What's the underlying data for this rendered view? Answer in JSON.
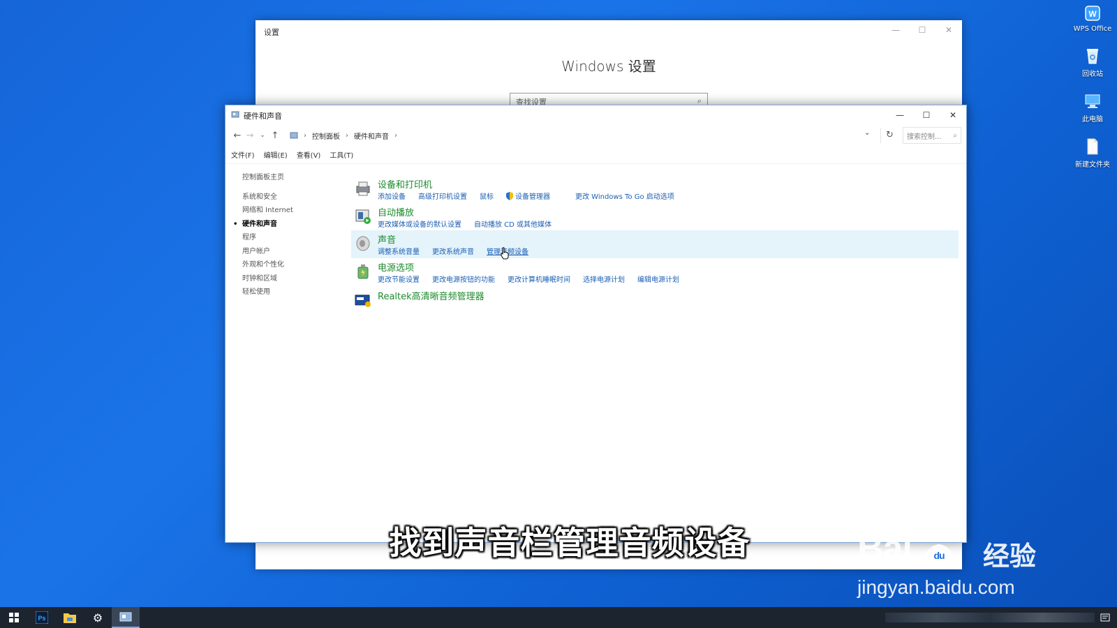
{
  "desktop": {
    "icons": [
      {
        "label": "WPS Office",
        "icon": "wps-office-icon"
      },
      {
        "label": "回收站",
        "icon": "recycle-bin-icon"
      },
      {
        "label": "此电脑",
        "icon": "this-pc-icon"
      },
      {
        "label": "新建文件夹",
        "icon": "new-folder-icon"
      }
    ]
  },
  "settings_window": {
    "title": "设置",
    "heading": "Windows 设置",
    "search_placeholder": "查找设置"
  },
  "control_panel": {
    "title": "硬件和声音",
    "breadcrumbs": [
      "控制面板",
      "硬件和声音"
    ],
    "search_placeholder": "搜索控制...",
    "menu": [
      "文件(F)",
      "编辑(E)",
      "查看(V)",
      "工具(T)"
    ],
    "left_nav": [
      {
        "label": "控制面板主页"
      },
      {
        "label": "系统和安全"
      },
      {
        "label": "网络和 Internet"
      },
      {
        "label": "硬件和声音",
        "active": true
      },
      {
        "label": "程序"
      },
      {
        "label": "用户帐户"
      },
      {
        "label": "外观和个性化"
      },
      {
        "label": "时钟和区域"
      },
      {
        "label": "轻松使用"
      }
    ],
    "categories": [
      {
        "title": "设备和打印机",
        "icon": "devices-printers-icon",
        "links": [
          "添加设备",
          "高级打印机设置",
          "鼠标",
          "设备管理器",
          "更改 Windows To Go 启动选项"
        ]
      },
      {
        "title": "自动播放",
        "icon": "autoplay-icon",
        "links": [
          "更改媒体或设备的默认设置",
          "自动播放 CD 或其他媒体"
        ]
      },
      {
        "title": "声音",
        "icon": "speaker-icon",
        "links": [
          "调整系统音量",
          "更改系统声音",
          "管理音频设备"
        ]
      },
      {
        "title": "电源选项",
        "icon": "power-options-icon",
        "links": [
          "更改节能设置",
          "更改电源按钮的功能",
          "更改计算机睡眠时间",
          "选择电源计划",
          "编辑电源计划"
        ]
      },
      {
        "title": "Realtek高清晰音频管理器",
        "icon": "realtek-icon",
        "links": []
      }
    ]
  },
  "subtitle": "找到声音栏管理音频设备",
  "watermark": {
    "brand": "Bai",
    "brand_cn": "经验",
    "url": "jingyan.baidu.com"
  },
  "colors": {
    "category_title": "#1d8a2d",
    "link": "#1a5fb4",
    "highlight": "#e5f3fb",
    "desktop": "#1a6fe0"
  }
}
